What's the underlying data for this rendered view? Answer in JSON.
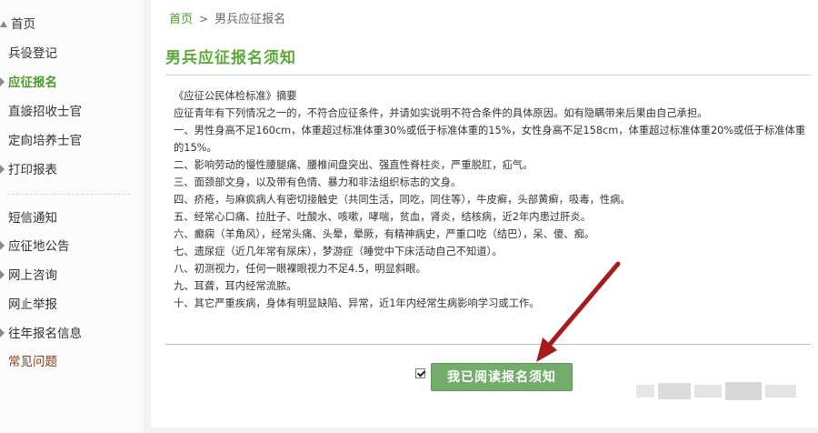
{
  "sidebar": {
    "items": [
      {
        "label": "首页",
        "icon": "home-icon"
      },
      {
        "label": "兵役登记",
        "icon": "doc-icon"
      },
      {
        "label": "应征报名",
        "icon": "arrow-right-icon",
        "active": true
      },
      {
        "label": "直接招收士官",
        "icon": "doc-icon"
      },
      {
        "label": "定向培养士官",
        "icon": "doc-icon"
      },
      {
        "label": "打印报表",
        "icon": "arrow-right-icon"
      },
      {
        "label": "短信通知",
        "icon": "doc-icon"
      },
      {
        "label": "应征地公告",
        "icon": "arrow-right-icon"
      },
      {
        "label": "网上咨询",
        "icon": "arrow-right-icon"
      },
      {
        "label": "网上举报",
        "icon": "doc-icon"
      },
      {
        "label": "往年报名信息",
        "icon": "arrow-right-icon"
      },
      {
        "label": "常见问题",
        "icon": "doc-icon"
      }
    ]
  },
  "breadcrumb": {
    "home": "首页",
    "separator": ">",
    "current": "男兵应征报名"
  },
  "page_title": "男兵应征报名须知",
  "doc": {
    "heading": "《应征公民体检标准》摘要",
    "intro": "应征青年有下列情况之一的，不符合应征条件，并请如实说明不符合条件的具体原因。如有隐瞒带来后果由自己承担。",
    "items": [
      "一、男性身高不足160cm，体重超过标准体重30%或低于标准体重的15%，女性身高不足158cm，体重超过标准体重20%或低于标准体重的15%。",
      "二、影响劳动的慢性腰腿痛、腰椎间盘突出、强直性脊柱炎，严重脱肛，疝气。",
      "三、面颈部文身，以及带有色情、暴力和非法组织标志的文身。",
      "四、疥疮，与麻疯病人有密切接触史（共同生活，同吃，同住等），牛皮癣，头部黄癣，吸毒，性病。",
      "五、经常心口痛、拉肚子、吐酸水、咳嗽，哮喘，贫血，肾炎，结核病，近2年内患过肝炎。",
      "六、癫痫（羊角风），经常头痛、头晕，晕厥，有精神病史，严重口吃（结巴），呆、傻、痴。",
      "七、遗尿症（近几年常有尿床），梦游症（睡觉中下床活动自己不知道）。",
      "八、初测视力，任何一眼裸眼视力不足4.5，明显斜眼。",
      "九、耳聋，耳内经常流脓。",
      "十、其它严重疾病，身体有明显缺陷、异常，近1年内经常生病影响学习或工作。"
    ]
  },
  "agreement": {
    "checked": true,
    "button_label": "我已阅读报名须知"
  },
  "colors": {
    "accent": "#5aaa3a",
    "active_nav": "#4d9a2a",
    "button": "#74ad6b",
    "annotation_arrow": "#a51c1c"
  }
}
